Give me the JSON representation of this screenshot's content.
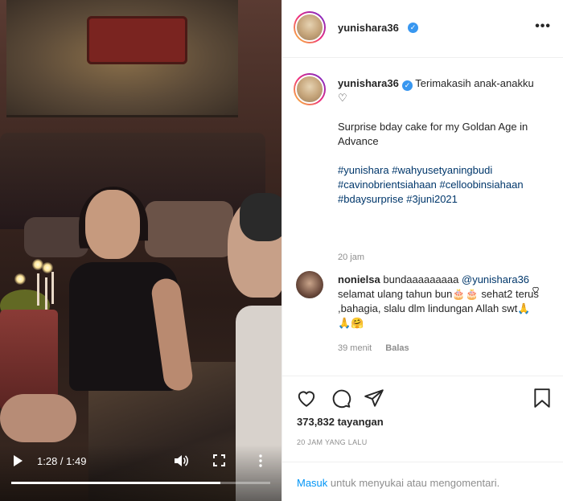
{
  "video": {
    "time_display": "1:28 / 1:49",
    "progress_fraction": 0.807
  },
  "header": {
    "username": "yunishara36",
    "verified": "✓",
    "more": "•••"
  },
  "caption": {
    "username": "yunishara36",
    "line1": "Terimakasih anak-anakku ♡",
    "line2": "Surprise bday cake for my Goldan Age in Advance",
    "hashtags": "#yunishara #wahyusetyaningbudi #cavinobrientsiahaan #celloobinsiahaan #bdaysurprise #3juni2021",
    "time": "20 jam"
  },
  "comment": {
    "username": "nonielsa",
    "text_start": "bundaaaaaaaaa",
    "mention": "@yunishara36",
    "text_rest": "selamat ulang tahun bun🎂🎂 sehat2 terus ,bahagia, slalu dlm lindungan Allah swt🙏🙏🤗",
    "time": "39 menit",
    "reply": "Balas"
  },
  "actions": {
    "views": "373,832 tayangan",
    "time_ago": "20 JAM YANG LALU",
    "login_link": "Masuk",
    "login_rest": " untuk menyukai atau mengomentari."
  },
  "icons": {
    "verified_color": "#3897f0",
    "link_color": "#00376b",
    "login_color": "#0095f6"
  }
}
